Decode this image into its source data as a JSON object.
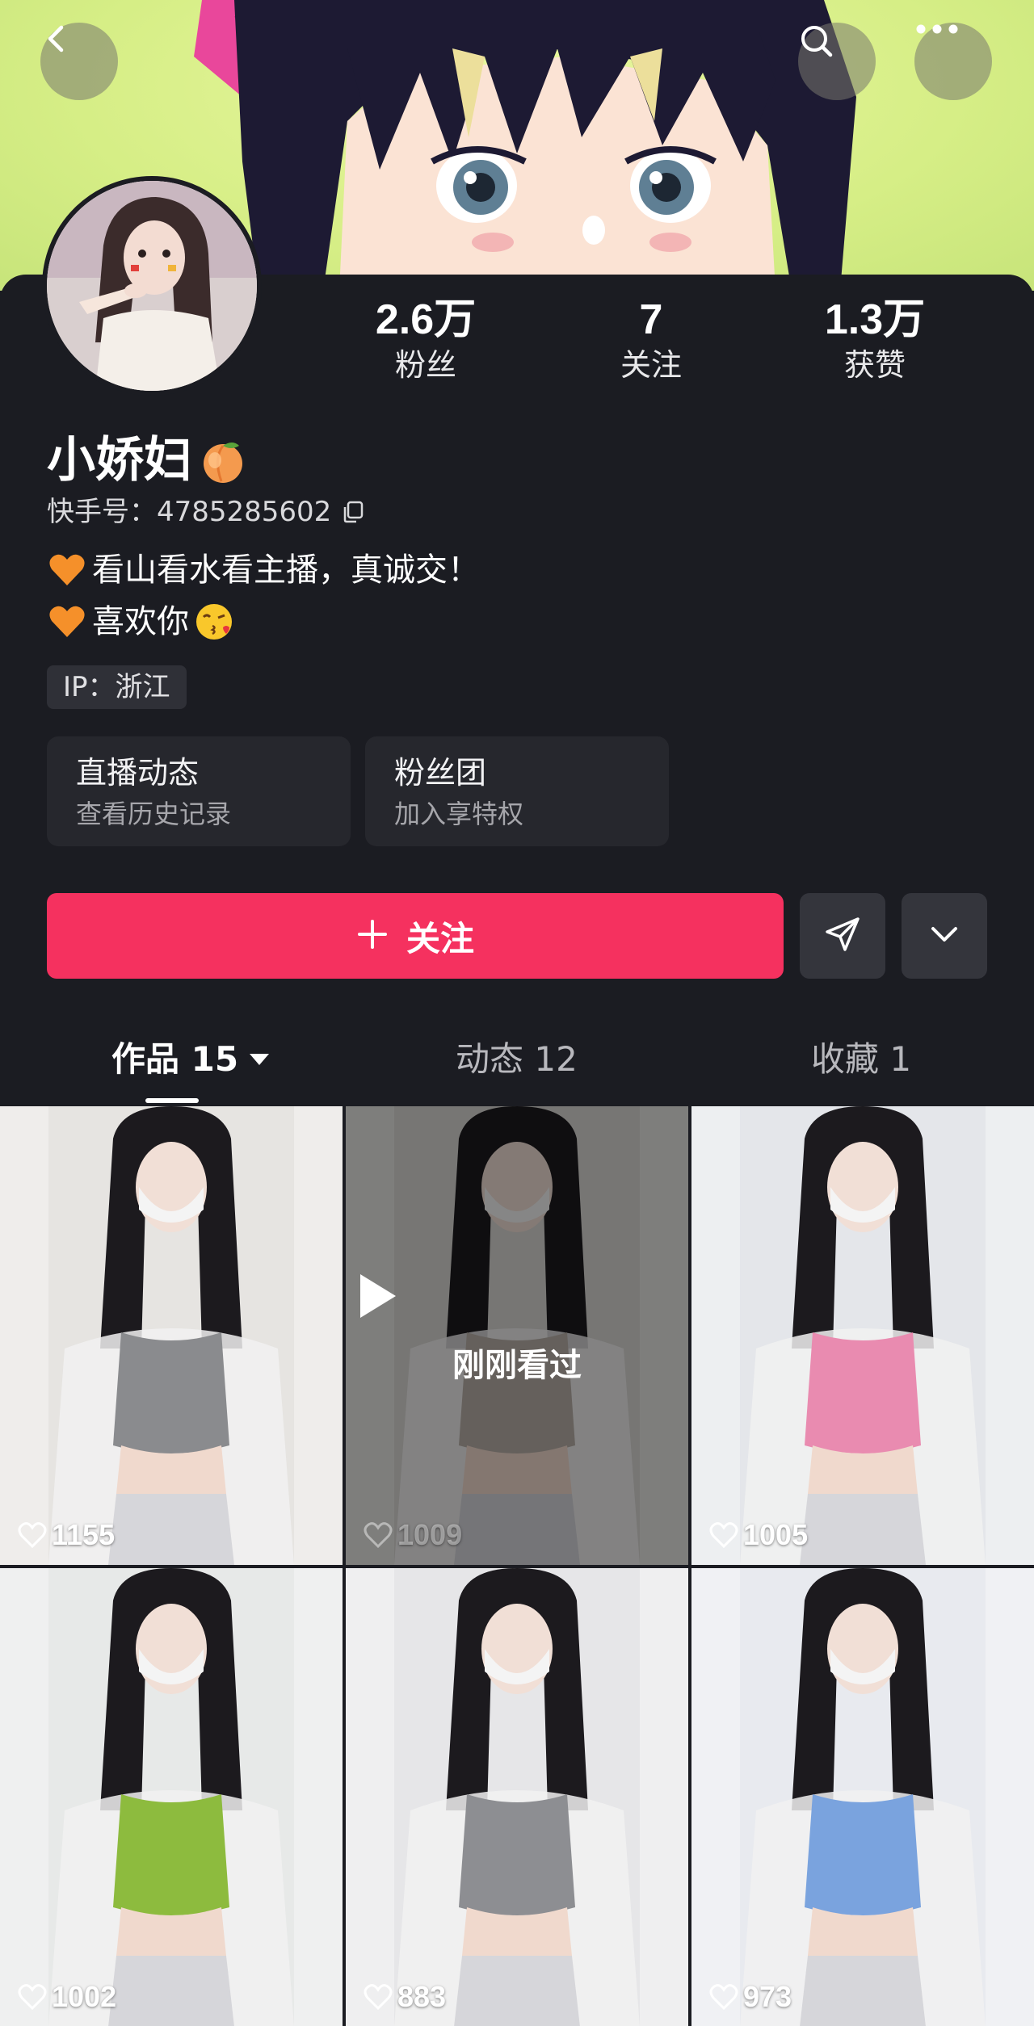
{
  "header": {
    "back_icon": "chevron-left-icon",
    "search_icon": "search-icon",
    "more_icon": "more-horizontal-icon"
  },
  "profile": {
    "nickname": "小娇妇",
    "nickname_emoji": "peach",
    "kuaishou_id_label": "快手号：",
    "kuaishou_id": "4785285602",
    "bio_line1": "看山看水看主播，真诚交！",
    "bio_line2": "喜欢你",
    "ip_tag": "IP：浙江"
  },
  "stats": {
    "fans": {
      "value": "2.6万",
      "label": "粉丝"
    },
    "following": {
      "value": "7",
      "label": "关注"
    },
    "likes": {
      "value": "1.3万",
      "label": "获赞"
    }
  },
  "cards": {
    "live": {
      "title": "直播动态",
      "subtitle": "查看历史记录"
    },
    "fan_club": {
      "title": "粉丝团",
      "subtitle": "加入享特权"
    }
  },
  "actions": {
    "follow_label": "关注",
    "share_icon": "send-icon",
    "expand_icon": "chevron-down-icon"
  },
  "tabs": [
    {
      "label": "作品 15",
      "active": true
    },
    {
      "label": "动态 12",
      "active": false
    },
    {
      "label": "收藏 1",
      "active": false
    }
  ],
  "videos": [
    {
      "likes": "1155",
      "top_color": "#e6e4e1",
      "outfit": "#8a8b8e"
    },
    {
      "likes": "1009",
      "top_color": "#d9d7d3",
      "outfit": "#b8b0a8",
      "played_label": "刚刚看过"
    },
    {
      "likes": "1005",
      "top_color": "#e4e6ea",
      "outfit": "#e98bb0"
    },
    {
      "likes": "1002",
      "top_color": "#e7e9e8",
      "outfit": "#8dbb3e"
    },
    {
      "likes": "883",
      "top_color": "#e6e6e8",
      "outfit": "#8d8e92"
    },
    {
      "likes": "973",
      "top_color": "#e8eaef",
      "outfit": "#7aa3de"
    }
  ]
}
